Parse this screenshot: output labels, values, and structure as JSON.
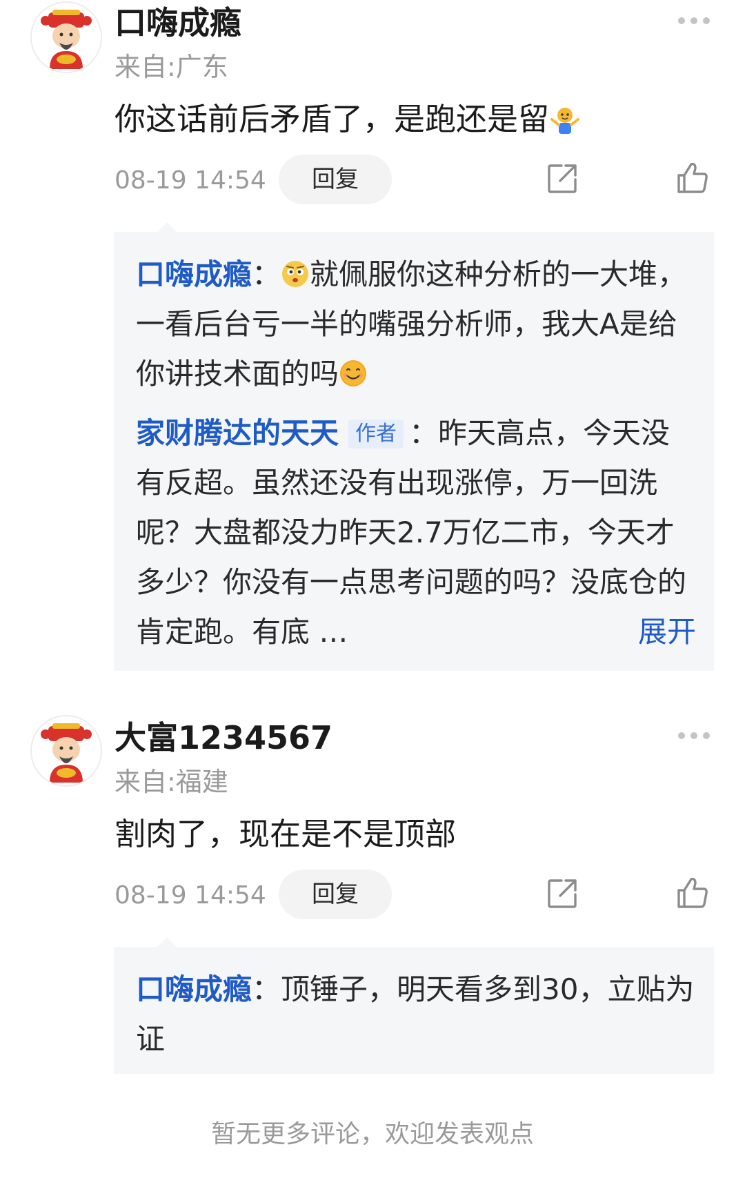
{
  "comments": [
    {
      "username": "口嗨成瘾",
      "location": "来自:广东",
      "content": "你这话前后矛盾了，是跑还是留",
      "content_emoji": "shrug-emoji",
      "timestamp": "08-19 14:54",
      "reply_label": "回复",
      "replies": [
        {
          "name": "口嗨成瘾",
          "separator": "：",
          "emoji": "thinking-face-emoji",
          "text": "就佩服你这种分析的一大堆，一看后台亏一半的嘴强分析师，我大A是给你讲技术面的吗",
          "trailing_emoji": "smile-emoji"
        },
        {
          "name": "家财腾达的天天",
          "badge": "作者",
          "separator": "：",
          "text": "昨天高点，今天没有反超。虽然还没有出现涨停，万一回洗呢？大盘都没力昨天2.7万亿二市，今天才多少？你没有一点思考问题的吗？没底仓的肯定跑。有底 …",
          "expand_label": "展开"
        }
      ]
    },
    {
      "username": "大富1234567",
      "location": "来自:福建",
      "content": "割肉了，现在是不是顶部",
      "timestamp": "08-19 14:54",
      "reply_label": "回复",
      "replies": [
        {
          "name": "口嗨成瘾",
          "separator": "：",
          "text": "顶锤子，明天看多到30，立贴为证"
        }
      ]
    }
  ],
  "footer": {
    "text": "暂无更多评论，欢迎发表观点"
  },
  "colors": {
    "link_blue": "#1e5bc6",
    "muted_gray": "#9a9a9a",
    "reply_bg": "#f5f6f8"
  }
}
